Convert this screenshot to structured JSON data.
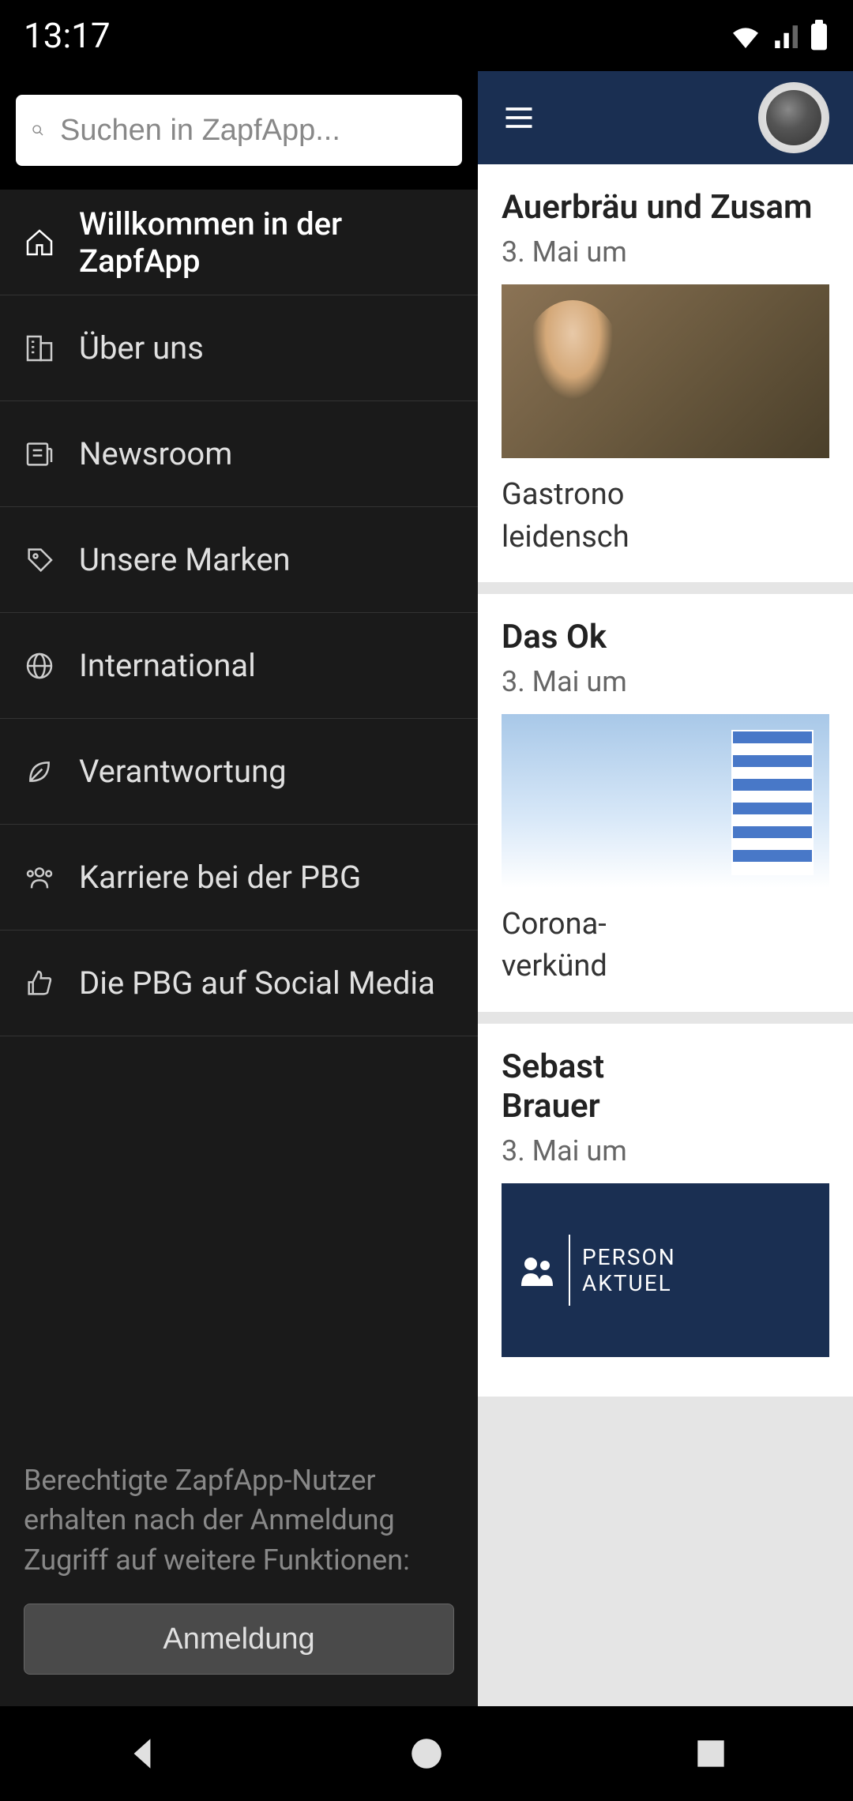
{
  "status": {
    "time": "13:17"
  },
  "search": {
    "placeholder": "Suchen in ZapfApp..."
  },
  "nav": {
    "items": [
      {
        "label": "Willkommen in der ZapfApp",
        "icon": "home"
      },
      {
        "label": "Über uns",
        "icon": "building"
      },
      {
        "label": "Newsroom",
        "icon": "news"
      },
      {
        "label": "Unsere Marken",
        "icon": "tag"
      },
      {
        "label": "International",
        "icon": "globe"
      },
      {
        "label": "Verantwortung",
        "icon": "leaf"
      },
      {
        "label": "Karriere bei der PBG",
        "icon": "people"
      },
      {
        "label": "Die PBG auf Social Media",
        "icon": "thumbsup"
      }
    ]
  },
  "login": {
    "hint": "Berechtigte ZapfApp-Nutzer erhalten nach der Anmeldung Zugriff auf weitere Funktionen:",
    "button": "Anmeldung"
  },
  "articles": [
    {
      "title": "Auerbräu und Zusam",
      "date": "3. Mai um",
      "summary_line1": "Gastrono",
      "summary_line2": "leidensch"
    },
    {
      "title": "Das Ok",
      "date": "3. Mai um",
      "summary_line1": "Corona-",
      "summary_line2": "verkünd"
    },
    {
      "title_line1": "Sebast",
      "title_line2": "Brauer",
      "date": "3. Mai um",
      "badge_line1": "PERSON",
      "badge_line2": "AKTUEL"
    }
  ]
}
